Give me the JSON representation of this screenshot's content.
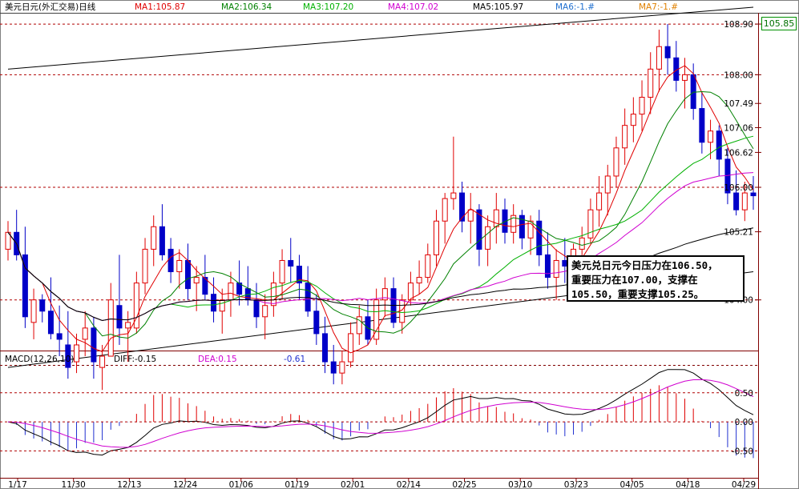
{
  "header": {
    "title": "美元日元(外汇交易)日线",
    "ma_labels": [
      {
        "text": "MA1:105.87",
        "color": "#e00000"
      },
      {
        "text": "MA2:106.34",
        "color": "#008000"
      },
      {
        "text": "MA3:107.20",
        "color": "#00b000"
      },
      {
        "text": "MA4:107.02",
        "color": "#d000d0"
      },
      {
        "text": "MA5:105.97",
        "color": "#000000"
      },
      {
        "text": "MA6:-1.#",
        "color": "#2070d0"
      },
      {
        "text": "MA7:-1.#",
        "color": "#e08000"
      }
    ]
  },
  "last_price_box": "105.85",
  "note": "美元兑日元今日压力在106.50，\n重要压力在107.00，支撑在\n105.50，重要支撑105.25。",
  "chart_data": [
    {
      "type": "candlestick",
      "name": "美元日元(外汇交易)日线",
      "ylim": [
        103.1,
        109.1
      ],
      "y_ticks": [
        "108.90",
        "108.00",
        "107.49",
        "107.06",
        "106.62",
        "106.00",
        "105.21",
        "104.00"
      ],
      "gridlines": [
        108.9,
        108.0,
        106.0,
        104.0
      ],
      "candles": [
        [
          104.9,
          105.4,
          104.7,
          105.2
        ],
        [
          105.2,
          105.6,
          104.7,
          104.8
        ],
        [
          104.8,
          105.3,
          103.5,
          103.7
        ],
        [
          103.6,
          104.2,
          103.3,
          104.0
        ],
        [
          104.0,
          104.1,
          103.6,
          103.8
        ],
        [
          103.8,
          104.4,
          103.3,
          103.4
        ],
        [
          103.4,
          103.9,
          103.0,
          103.3
        ],
        [
          103.2,
          103.8,
          102.6,
          102.8
        ],
        [
          102.9,
          103.4,
          102.7,
          103.2
        ],
        [
          103.3,
          103.8,
          103.0,
          103.5
        ],
        [
          103.5,
          103.7,
          102.6,
          102.9
        ],
        [
          102.8,
          103.2,
          102.4,
          103.0
        ],
        [
          103.0,
          104.3,
          103.0,
          104.0
        ],
        [
          103.9,
          104.8,
          103.2,
          103.5
        ],
        [
          103.5,
          103.8,
          102.9,
          103.6
        ],
        [
          103.5,
          104.5,
          103.4,
          104.3
        ],
        [
          104.3,
          105.1,
          104.1,
          104.9
        ],
        [
          104.9,
          105.5,
          104.6,
          105.3
        ],
        [
          105.3,
          105.7,
          104.7,
          104.8
        ],
        [
          104.9,
          105.1,
          104.3,
          104.5
        ],
        [
          104.5,
          104.9,
          104.2,
          104.7
        ],
        [
          104.7,
          105.0,
          104.0,
          104.2
        ],
        [
          104.3,
          104.6,
          103.8,
          104.4
        ],
        [
          104.4,
          104.8,
          104.0,
          104.1
        ],
        [
          104.1,
          104.4,
          103.6,
          103.8
        ],
        [
          103.8,
          104.2,
          103.4,
          104.0
        ],
        [
          104.0,
          104.5,
          103.7,
          104.3
        ],
        [
          104.3,
          104.7,
          103.9,
          104.1
        ],
        [
          104.2,
          104.6,
          103.9,
          104.0
        ],
        [
          104.0,
          104.3,
          103.5,
          103.7
        ],
        [
          103.7,
          104.1,
          103.3,
          103.9
        ],
        [
          103.9,
          104.5,
          103.7,
          104.3
        ],
        [
          104.3,
          104.9,
          104.0,
          104.7
        ],
        [
          104.7,
          105.1,
          104.3,
          104.6
        ],
        [
          104.6,
          104.8,
          104.0,
          104.3
        ],
        [
          104.3,
          104.6,
          103.7,
          103.8
        ],
        [
          103.8,
          104.1,
          103.2,
          103.4
        ],
        [
          103.4,
          103.7,
          102.7,
          102.9
        ],
        [
          102.9,
          103.2,
          102.5,
          102.7
        ],
        [
          102.7,
          103.1,
          102.5,
          102.9
        ],
        [
          102.9,
          103.6,
          102.8,
          103.4
        ],
        [
          103.4,
          103.9,
          103.2,
          103.7
        ],
        [
          103.7,
          104.0,
          103.2,
          103.3
        ],
        [
          103.3,
          104.2,
          103.2,
          104.0
        ],
        [
          104.0,
          104.4,
          103.7,
          104.2
        ],
        [
          104.2,
          104.4,
          103.5,
          103.6
        ],
        [
          103.6,
          104.1,
          103.4,
          104.0
        ],
        [
          104.0,
          104.5,
          103.9,
          104.3
        ],
        [
          104.3,
          104.7,
          104.1,
          104.4
        ],
        [
          104.4,
          105.0,
          104.3,
          104.8
        ],
        [
          104.8,
          105.6,
          104.6,
          105.4
        ],
        [
          105.4,
          105.9,
          105.0,
          105.8
        ],
        [
          105.8,
          106.9,
          105.6,
          105.9
        ],
        [
          105.9,
          106.1,
          105.2,
          105.4
        ],
        [
          105.4,
          105.9,
          105.0,
          105.6
        ],
        [
          105.6,
          105.7,
          104.6,
          104.9
        ],
        [
          104.9,
          105.5,
          104.6,
          105.3
        ],
        [
          105.3,
          105.9,
          105.0,
          105.6
        ],
        [
          105.6,
          105.8,
          105.0,
          105.2
        ],
        [
          105.2,
          105.7,
          105.0,
          105.5
        ],
        [
          105.5,
          105.6,
          104.9,
          105.1
        ],
        [
          105.1,
          105.5,
          104.8,
          105.4
        ],
        [
          105.4,
          105.6,
          104.6,
          104.8
        ],
        [
          104.8,
          105.2,
          104.2,
          104.4
        ],
        [
          104.4,
          104.9,
          104.0,
          104.7
        ],
        [
          104.7,
          105.1,
          104.3,
          104.6
        ],
        [
          104.6,
          105.0,
          104.2,
          104.9
        ],
        [
          104.9,
          105.3,
          104.5,
          105.1
        ],
        [
          105.1,
          105.8,
          105.0,
          105.6
        ],
        [
          105.6,
          106.2,
          105.3,
          105.9
        ],
        [
          105.9,
          106.4,
          105.5,
          106.2
        ],
        [
          106.2,
          106.9,
          106.0,
          106.7
        ],
        [
          106.7,
          107.4,
          106.4,
          107.1
        ],
        [
          107.1,
          107.6,
          106.8,
          107.3
        ],
        [
          107.3,
          107.9,
          107.0,
          107.6
        ],
        [
          107.6,
          108.4,
          107.3,
          108.1
        ],
        [
          108.1,
          108.8,
          107.7,
          108.5
        ],
        [
          108.5,
          108.9,
          108.0,
          108.3
        ],
        [
          108.3,
          108.6,
          107.7,
          107.9
        ],
        [
          107.9,
          108.3,
          107.4,
          108.0
        ],
        [
          108.0,
          108.2,
          107.2,
          107.4
        ],
        [
          107.4,
          107.7,
          106.6,
          106.8
        ],
        [
          106.8,
          107.2,
          106.5,
          107.0
        ],
        [
          107.0,
          107.1,
          106.2,
          106.5
        ],
        [
          106.5,
          106.7,
          105.7,
          105.9
        ],
        [
          105.9,
          106.3,
          105.5,
          105.6
        ],
        [
          105.6,
          106.1,
          105.4,
          105.9
        ],
        [
          105.9,
          106.2,
          105.6,
          105.85
        ]
      ],
      "ma_series": [
        {
          "name": "MA1",
          "color": "#e00000",
          "period": 5
        },
        {
          "name": "MA2",
          "color": "#008000",
          "period": 10
        },
        {
          "name": "MA3",
          "color": "#00b000",
          "period": 20
        },
        {
          "name": "MA4",
          "color": "#d000d0",
          "period": 30
        },
        {
          "name": "MA5",
          "color": "#000000",
          "period": 60
        }
      ],
      "trend_channel": {
        "upper": [
          {
            "bar": 0,
            "price": 108.1
          },
          {
            "bar": 87,
            "price": 109.2
          }
        ],
        "lower": [
          {
            "bar": 0,
            "price": 102.8
          },
          {
            "bar": 87,
            "price": 104.5
          }
        ]
      }
    },
    {
      "type": "macd",
      "title": "MACD(12,26,10)",
      "values": {
        "DIFF": "-0.15",
        "DEA": "0.15",
        "MACD": "-0.61"
      },
      "ylim": [
        -0.95,
        1.2
      ],
      "y_ticks": [
        "0.50",
        "0.00",
        "-0.50"
      ],
      "x_tick_labels": [
        "1/17",
        "11/30",
        "12/13",
        "12/24",
        "01/06",
        "01/19",
        "02/01",
        "02/14",
        "02/25",
        "03/10",
        "03/23",
        "04/05",
        "04/18",
        "04/29"
      ]
    }
  ]
}
